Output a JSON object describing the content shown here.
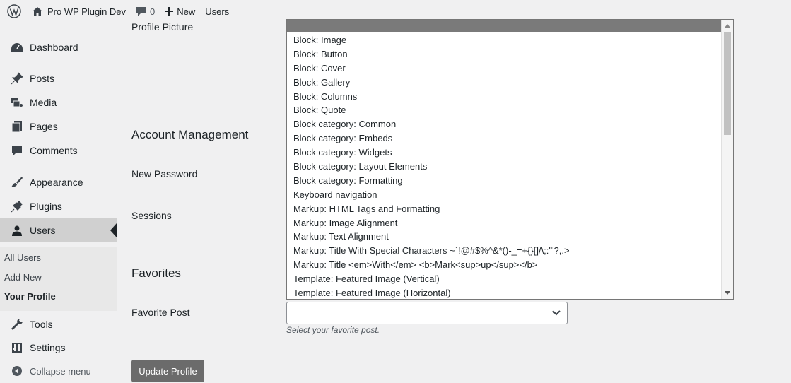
{
  "adminbar": {
    "site_name": "Pro WP Plugin Dev",
    "comments_count": "0",
    "new_label": "New",
    "users_label": "Users"
  },
  "sidebar": {
    "items": [
      {
        "label": "Dashboard",
        "icon": "dashboard-icon"
      },
      {
        "label": "Posts",
        "icon": "pin-icon"
      },
      {
        "label": "Media",
        "icon": "media-icon"
      },
      {
        "label": "Pages",
        "icon": "pages-icon"
      },
      {
        "label": "Comments",
        "icon": "comment-icon"
      },
      {
        "label": "Appearance",
        "icon": "brush-icon"
      },
      {
        "label": "Plugins",
        "icon": "plug-icon"
      },
      {
        "label": "Users",
        "icon": "users-icon"
      },
      {
        "label": "Tools",
        "icon": "wrench-icon"
      },
      {
        "label": "Settings",
        "icon": "settings-icon"
      }
    ],
    "submenu": {
      "all_users": "All Users",
      "add_new": "Add New",
      "your_profile": "Your Profile"
    },
    "collapse_label": "Collapse menu"
  },
  "main": {
    "profile_picture_label": "Profile Picture",
    "account_management_title": "Account Management",
    "new_password_label": "New Password",
    "sessions_label": "Sessions",
    "favorites_title": "Favorites",
    "favorite_post_label": "Favorite Post",
    "favorite_post_value": "",
    "favorite_post_description": "Select your favorite post.",
    "update_button": "Update Profile"
  },
  "dropdown": {
    "options": [
      "Block: Image",
      "Block: Button",
      "Block: Cover",
      "Block: Gallery",
      "Block: Columns",
      "Block: Quote",
      "Block category: Common",
      "Block category: Embeds",
      "Block category: Widgets",
      "Block category: Layout Elements",
      "Block category: Formatting",
      "Keyboard navigation",
      "Markup: HTML Tags and Formatting",
      "Markup: Image Alignment",
      "Markup: Text Alignment",
      "Markup: Title With Special Characters ~`!@#$%^&*()-_=+{}[]/\\;:'\"?,.>",
      "Markup: Title <em>With</em> <b>Mark<sup>up</sup></b>",
      "Template: Featured Image (Vertical)",
      "Template: Featured Image (Horizontal)"
    ]
  },
  "colors": {
    "sidebar_bg": "#f0f0f1",
    "active_bg": "#d0d0d0",
    "button_bg": "#6b6b6b",
    "highlight": "#7a7a7a"
  }
}
